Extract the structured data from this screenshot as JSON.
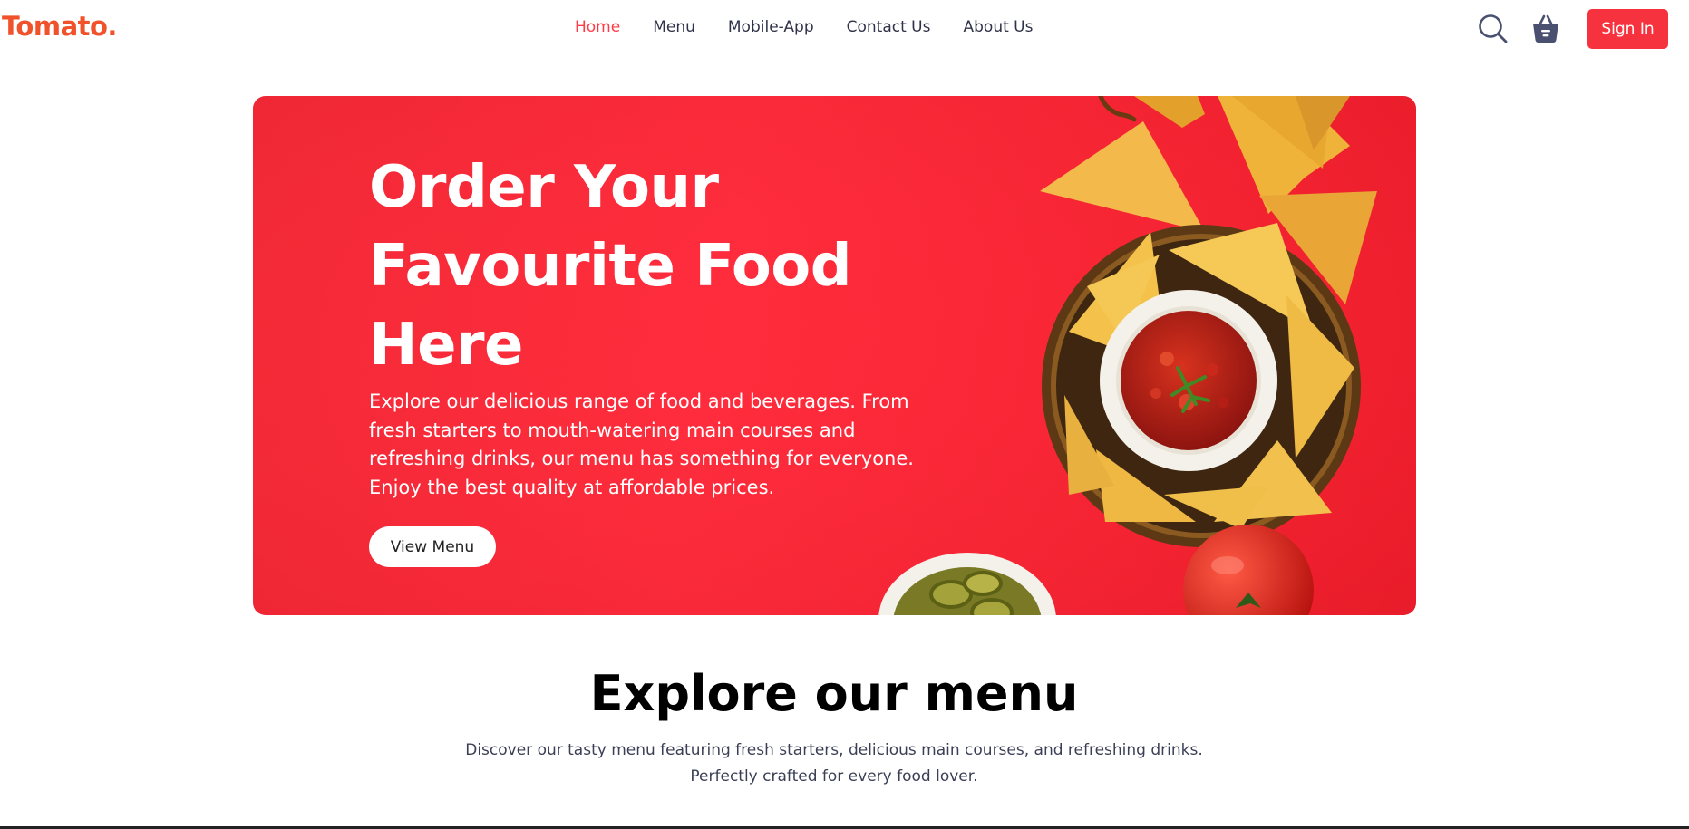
{
  "navbar": {
    "logo": "Tomato.",
    "links": [
      "Home",
      "Menu",
      "Mobile-App",
      "Contact Us",
      "About Us"
    ],
    "active_link": "Home",
    "search_icon": "search-icon",
    "basket_icon": "basket-icon",
    "signin_label": "Sign In"
  },
  "hero": {
    "title": "Order Your Favourite Food Here",
    "description": "Explore our delicious range of food and beverages. From fresh starters to mouth-watering main courses and refreshing drinks, our menu has something for everyone. Enjoy the best quality at affordable prices.",
    "button_label": "View Menu"
  },
  "explore": {
    "title": "Explore our menu",
    "description_line1": "Discover our tasty menu featuring fresh starters, delicious main courses, and refreshing drinks.",
    "description_line2": "Perfectly crafted for every food lover."
  },
  "colors": {
    "brand": "#f0532c",
    "accent": "#f7323f",
    "hero_bg": "#ff2c3c",
    "text_dark": "#2f3349"
  }
}
